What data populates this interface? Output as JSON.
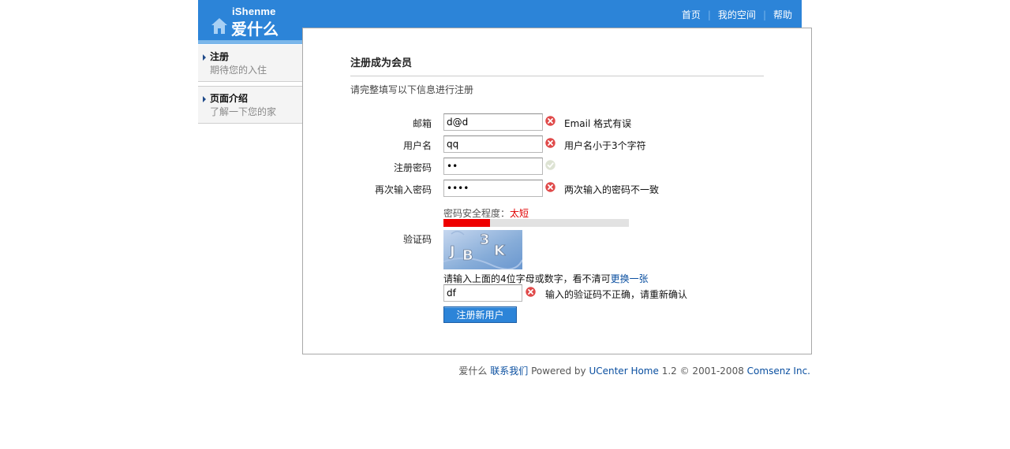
{
  "header": {
    "logo_en": "iShenme",
    "logo_cn": "爱什么",
    "nav": [
      {
        "label": "首页"
      },
      {
        "label": "我的空间"
      },
      {
        "label": "帮助"
      }
    ],
    "colors": {
      "bar": "#2c84d8",
      "stripe": "#7ab6ea"
    }
  },
  "sidebar": {
    "items": [
      {
        "title": "注册",
        "subtitle": "期待您的入住"
      },
      {
        "title": "页面介绍",
        "subtitle": "了解一下您的家"
      }
    ]
  },
  "form": {
    "title": "注册成为会员",
    "intro": "请完整填写以下信息进行注册",
    "fields": [
      {
        "label": "邮箱",
        "value": "d@d",
        "type": "text",
        "status": "error",
        "icon": "error-icon",
        "message": "Email 格式有误"
      },
      {
        "label": "用户名",
        "value": "qq",
        "type": "text",
        "status": "error",
        "icon": "error-icon",
        "message": "用户名小于3个字符"
      },
      {
        "label": "注册密码",
        "value": "aa",
        "type": "password",
        "status": "ok",
        "icon": "check-icon",
        "message": ""
      },
      {
        "label": "再次输入密码",
        "value": "aaaa",
        "type": "password",
        "status": "error",
        "icon": "error-icon",
        "message": "两次输入的密码不一致"
      }
    ],
    "strength": {
      "label": "密码安全程度：",
      "value": "太短",
      "level": 0.25,
      "color": "#ee0000"
    },
    "captcha": {
      "label": "验证码",
      "image_text": "JB3K",
      "tip": "请输入上面的4位字母或数字，看不清可",
      "refresh_link": "更换一张",
      "value": "df",
      "icon": "error-icon",
      "message": "输入的验证码不正确，请重新确认"
    },
    "submit_label": "注册新用户"
  },
  "footer": {
    "site": "爱什么",
    "contact": "联系我们",
    "powered_by": "Powered by",
    "product": "UCenter Home",
    "version": "1.2 © 2001-2008",
    "company": "Comsenz Inc."
  }
}
